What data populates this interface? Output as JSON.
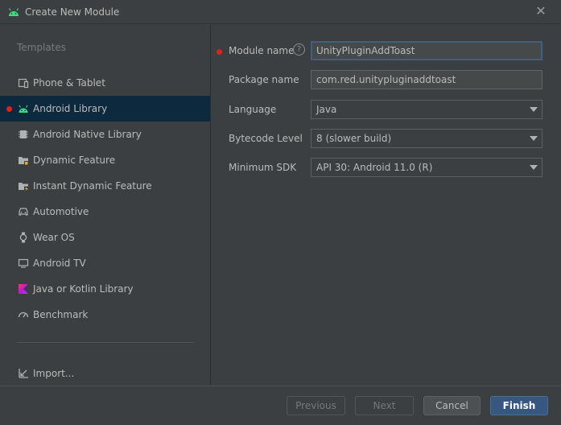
{
  "window": {
    "title": "Create New Module"
  },
  "sidebar": {
    "section_label": "Templates",
    "items": [
      {
        "label": "Phone & Tablet",
        "icon": "phone-tablet-icon"
      },
      {
        "label": "Android Library",
        "icon": "android-icon",
        "selected": true
      },
      {
        "label": "Android Native Library",
        "icon": "chip-icon"
      },
      {
        "label": "Dynamic Feature",
        "icon": "folder-feature-icon"
      },
      {
        "label": "Instant Dynamic Feature",
        "icon": "folder-instant-icon"
      },
      {
        "label": "Automotive",
        "icon": "car-icon"
      },
      {
        "label": "Wear OS",
        "icon": "watch-icon"
      },
      {
        "label": "Android TV",
        "icon": "tv-icon"
      },
      {
        "label": "Java or Kotlin Library",
        "icon": "kotlin-icon"
      },
      {
        "label": "Benchmark",
        "icon": "gauge-icon"
      }
    ],
    "import_label": "Import..."
  },
  "form": {
    "module_name": {
      "label": "Module name",
      "value": "UnityPluginAddToast",
      "help": "?"
    },
    "package_name": {
      "label": "Package name",
      "value": "com.red.unitypluginaddtoast"
    },
    "language": {
      "label": "Language",
      "value": "Java"
    },
    "bytecode": {
      "label": "Bytecode Level",
      "value": "8 (slower build)"
    },
    "min_sdk": {
      "label": "Minimum SDK",
      "value": "API 30: Android 11.0 (R)"
    }
  },
  "footer": {
    "previous": "Previous",
    "next": "Next",
    "cancel": "Cancel",
    "finish": "Finish"
  },
  "colors": {
    "accent": "#365880",
    "selection": "#0d293e",
    "required": "#e0211d",
    "android_green": "#3ddc84"
  }
}
